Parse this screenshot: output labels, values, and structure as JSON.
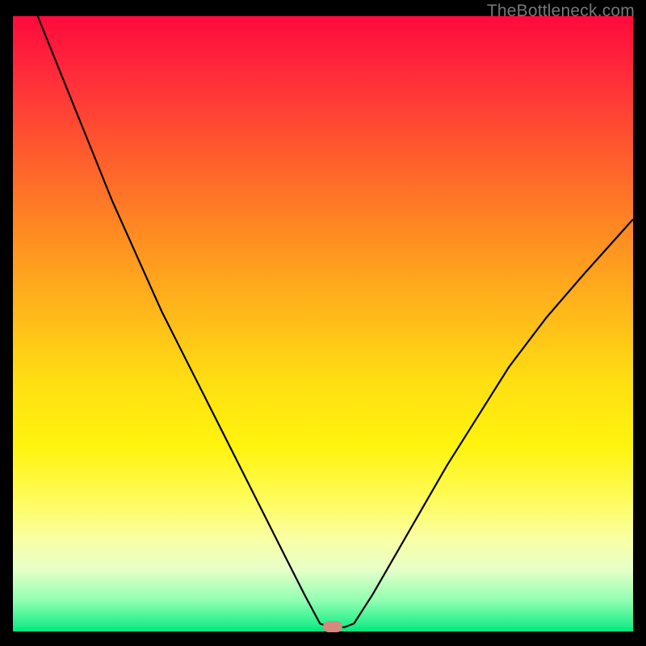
{
  "watermark": "TheBottleneck.com",
  "chart_data": {
    "type": "line",
    "title": "",
    "xlabel": "",
    "ylabel": "",
    "xlim": [
      0,
      100
    ],
    "ylim": [
      0,
      100
    ],
    "grid": false,
    "series": [
      {
        "name": "curve",
        "x": [
          4,
          8,
          12,
          16,
          20,
          24,
          28,
          32,
          36,
          40,
          44,
          47,
          49.5,
          51,
          53.5,
          55,
          58,
          62,
          66,
          70,
          75,
          80,
          86,
          92,
          100
        ],
        "y": [
          100,
          90,
          80,
          70,
          61,
          52,
          44,
          36,
          28,
          20,
          12,
          6,
          1.3,
          0.7,
          0.7,
          1.3,
          6,
          13,
          20,
          27,
          35,
          43,
          51,
          58,
          67
        ]
      }
    ],
    "flat_bottom": {
      "x_start": 49.5,
      "x_end": 53.5,
      "y": 0.7
    },
    "marker": {
      "x": 51.5,
      "y": 0.7,
      "color": "#d58a80"
    },
    "background_gradient": {
      "stops": [
        {
          "pos": 0.0,
          "color": "#ff0a3c"
        },
        {
          "pos": 0.35,
          "color": "#ff8a22"
        },
        {
          "pos": 0.6,
          "color": "#ffe012"
        },
        {
          "pos": 0.85,
          "color": "#f9ffa4"
        },
        {
          "pos": 1.0,
          "color": "#00e57a"
        }
      ]
    }
  }
}
